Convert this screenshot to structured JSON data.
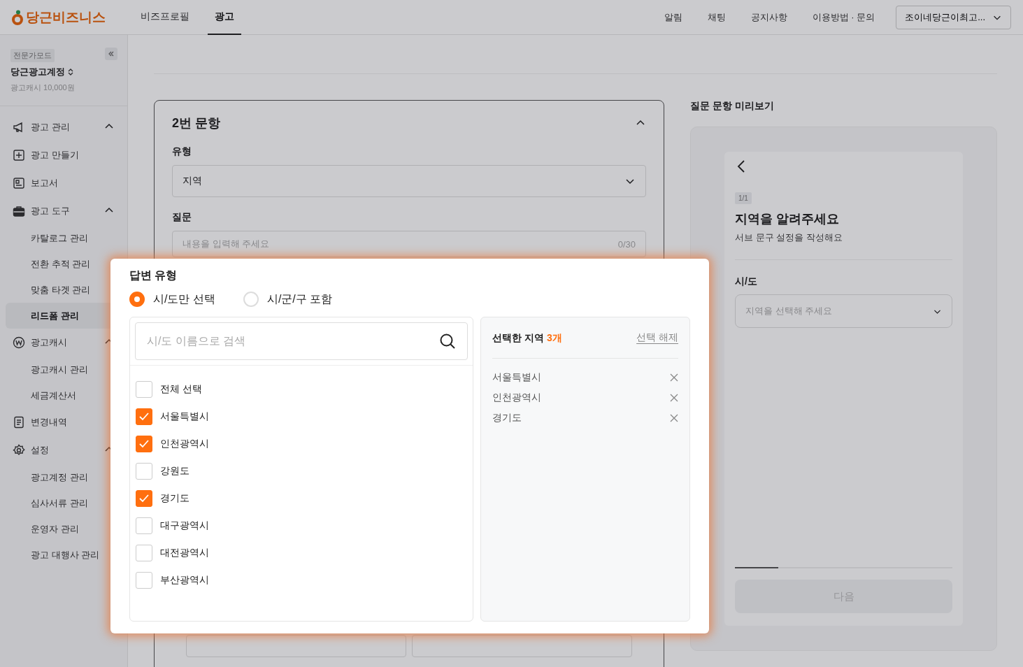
{
  "header": {
    "logo": "당근비즈니스",
    "tabs": [
      {
        "label": "비즈프로필",
        "selected": false
      },
      {
        "label": "광고",
        "selected": true
      }
    ],
    "links": [
      "알림",
      "채팅",
      "공지사항",
      "이용방법 · 문의"
    ],
    "account": "조이네당근이최고..."
  },
  "sidebar": {
    "mode_badge": "전문가모드",
    "account_name": "당근광고계정",
    "balance": "광고캐시 10,000원",
    "items": [
      {
        "label": "광고 관리",
        "expanded": true,
        "children": [
          {
            "label": "광고 만들기",
            "selected": false
          },
          {
            "label": "보고서",
            "selected": false
          }
        ]
      },
      {
        "label": "광고 도구",
        "expanded": true,
        "children": [
          {
            "label": "카탈로그 관리",
            "selected": false
          },
          {
            "label": "전환 추적 관리",
            "selected": false
          },
          {
            "label": "맞춤 타겟 관리",
            "selected": false
          },
          {
            "label": "리드폼 관리",
            "selected": true
          }
        ]
      },
      {
        "label": "광고캐시",
        "expanded": true,
        "children": [
          {
            "label": "광고캐시 관리",
            "selected": false
          },
          {
            "label": "세금계산서",
            "selected": false
          }
        ]
      },
      {
        "label": "변경내역"
      },
      {
        "label": "설정",
        "expanded": true,
        "children": [
          {
            "label": "광고계정 관리",
            "selected": false
          },
          {
            "label": "심사서류 관리",
            "selected": false
          },
          {
            "label": "운영자 관리",
            "selected": false
          },
          {
            "label": "광고 대행사 관리",
            "selected": false
          }
        ]
      }
    ]
  },
  "question_card": {
    "title": "2번 문항",
    "type_label": "유형",
    "type_value": "지역",
    "question_label": "질문",
    "question_placeholder": "내용을 입력해 주세요",
    "question_counter": "0/30"
  },
  "answer_popup": {
    "title": "답변 유형",
    "options": [
      {
        "label": "시/도만 선택",
        "selected": true
      },
      {
        "label": "시/군/구 포함",
        "selected": false
      }
    ],
    "search_placeholder": "시/도 이름으로 검색",
    "regions": [
      {
        "label": "전체 선택",
        "checked": false
      },
      {
        "label": "서울특별시",
        "checked": true
      },
      {
        "label": "인천광역시",
        "checked": true
      },
      {
        "label": "강원도",
        "checked": false
      },
      {
        "label": "경기도",
        "checked": true
      },
      {
        "label": "대구광역시",
        "checked": false
      },
      {
        "label": "대전광역시",
        "checked": false
      },
      {
        "label": "부산광역시",
        "checked": false
      }
    ],
    "selected_title": "선택한 지역",
    "selected_count": "3개",
    "clear_link": "선택 해제",
    "selected_regions": [
      "서울특별시",
      "인천광역시",
      "경기도"
    ]
  },
  "preview": {
    "title": "질문 문항 미리보기",
    "step": "1/1",
    "question": "지역을 알려주세요",
    "subtext": "서브 문구 설정을 작성해요",
    "field_label": "시/도",
    "field_placeholder": "지역을 선택해 주세요",
    "level": 0.2,
    "next_button": "다음"
  }
}
